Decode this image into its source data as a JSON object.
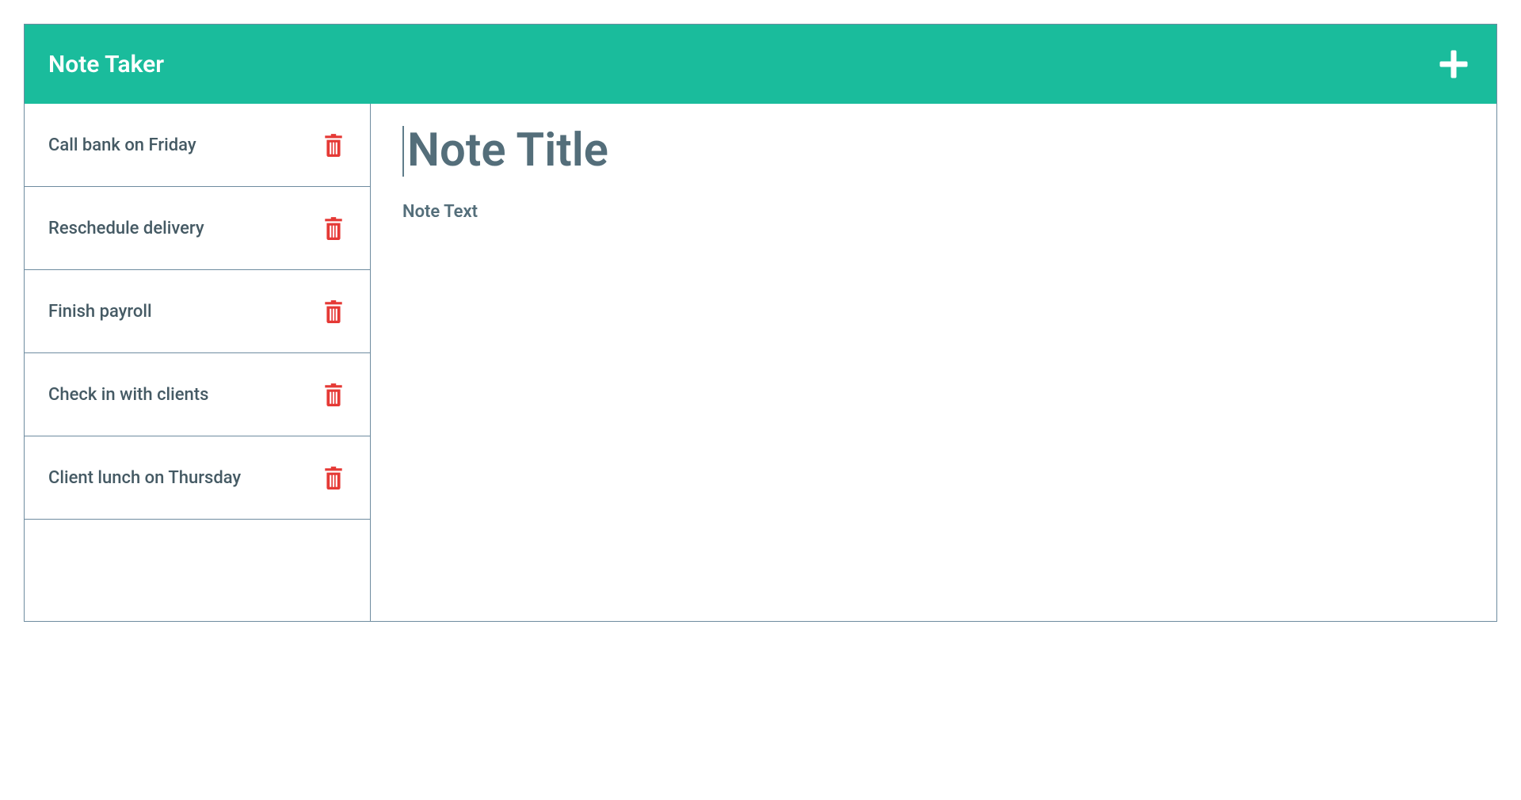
{
  "header": {
    "title": "Note Taker",
    "add_icon": "plus-icon"
  },
  "sidebar": {
    "items": [
      {
        "label": "Call bank on Friday"
      },
      {
        "label": "Reschedule delivery"
      },
      {
        "label": "Finish payroll"
      },
      {
        "label": "Check in with clients"
      },
      {
        "label": "Client lunch on Thursday"
      }
    ]
  },
  "editor": {
    "title_placeholder": "Note Title",
    "title_value": "",
    "text_placeholder": "Note Text",
    "text_value": ""
  },
  "colors": {
    "accent": "#1abc9c",
    "text": "#455a64",
    "border": "#6e8ca0",
    "danger": "#e53935"
  }
}
